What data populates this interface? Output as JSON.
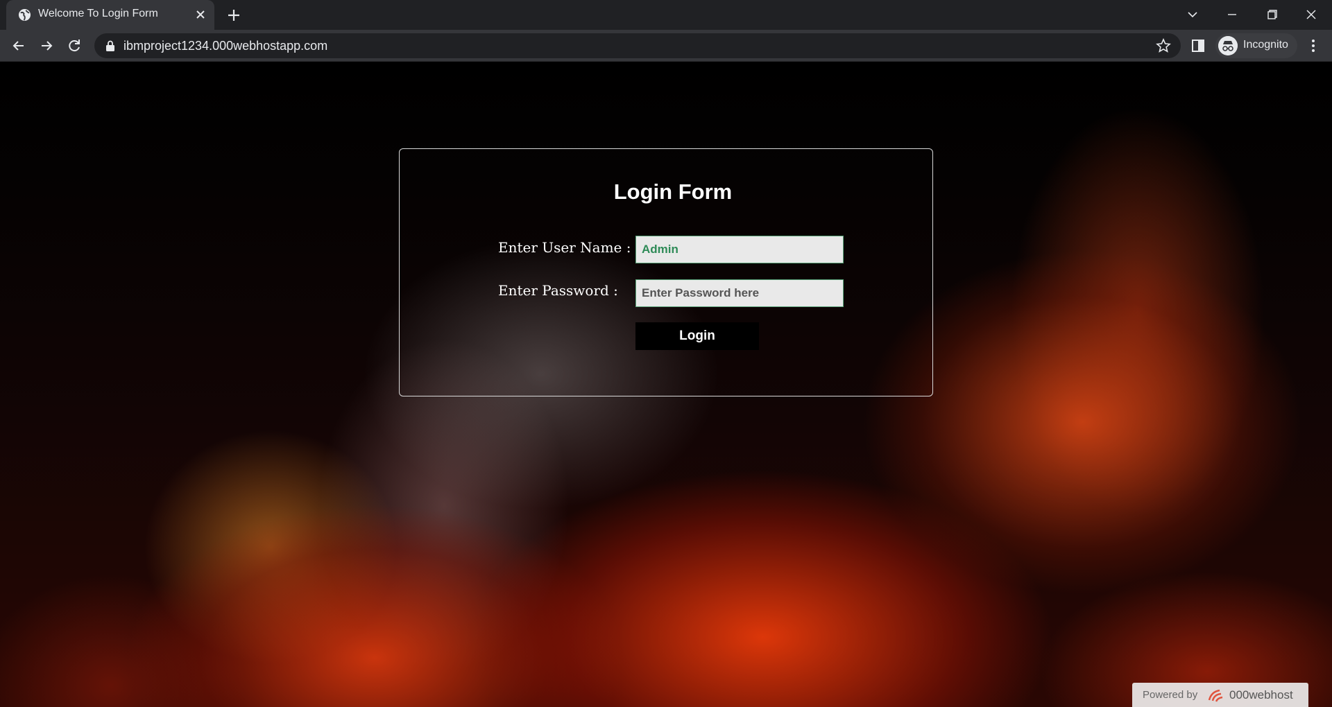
{
  "browser": {
    "tab_title": "Welcome To Login Form",
    "url": "ibmproject1234.000webhostapp.com",
    "profile_label": "Incognito"
  },
  "page": {
    "form_title": "Login Form",
    "username_label": "Enter User Name :",
    "username_value": "Admin",
    "password_label": "Enter Password :",
    "password_placeholder": "Enter Password here",
    "login_button": "Login"
  },
  "footer": {
    "powered_by": "Powered by",
    "brand": "000webhost"
  },
  "colors": {
    "tab_bar": "#202124",
    "toolbar": "#35363a",
    "username_text": "#2e8b57",
    "input_border": "#5aa57a"
  }
}
